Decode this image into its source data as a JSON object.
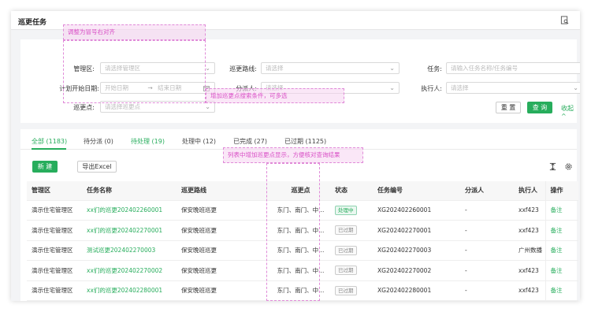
{
  "page_title": "巡更任务",
  "filters": {
    "area_label": "管理区:",
    "area_placeholder": "请选择管理区",
    "route_label": "巡更路线:",
    "route_placeholder": "请选择",
    "task_label": "任务:",
    "task_placeholder": "请输入任务名称/任务编号",
    "start_date_label": "计划开始日期:",
    "start_placeholder": "开始日期",
    "date_arrow": "→",
    "end_placeholder": "结束日期",
    "assigner_label": "分派人:",
    "assigner_placeholder": "请选择",
    "executor_label": "执行人:",
    "executor_placeholder": "请选择",
    "point_label": "巡更点:",
    "point_placeholder": "请选择巡更点",
    "reset_label": "重 置",
    "query_label": "查 询",
    "collapse_label": "收起 ^"
  },
  "tabs": [
    {
      "label": "全部 (1183)"
    },
    {
      "label": "待分派 (0)"
    },
    {
      "label": "待处理 (19)"
    },
    {
      "label": "处理中 (12)"
    },
    {
      "label": "已完成 (27)"
    },
    {
      "label": "已过期 (1125)"
    }
  ],
  "toolbar": {
    "new_label": "新 建",
    "export_label": "导出Excel"
  },
  "table": {
    "headers": [
      "管理区",
      "任务名称",
      "巡更路线",
      "巡更点",
      "状态",
      "任务编号",
      "分派人",
      "执行人",
      "操作"
    ],
    "rows": [
      {
        "area": "演示住宅管理区",
        "name": "xx们的巡更202402260001",
        "route": "保安晚班巡更",
        "points": "东门、南门、中...",
        "status": "处理中",
        "code": "XG202402260001",
        "assigner": "-",
        "executor": "xxf423",
        "op": "备注"
      },
      {
        "area": "演示住宅管理区",
        "name": "xx们的巡更202402270001",
        "route": "保安晚班巡更",
        "points": "东门、南门、中...",
        "status": "已过期",
        "code": "XG202402270001",
        "assigner": "-",
        "executor": "xxf423",
        "op": "备注"
      },
      {
        "area": "演示住宅管理区",
        "name": "测试巡更202402270003",
        "route": "保安晚班巡更",
        "points": "东门、南门、中...",
        "status": "已过期",
        "code": "XG202402270003",
        "assigner": "-",
        "executor": "广州数播",
        "op": "备注"
      },
      {
        "area": "演示住宅管理区",
        "name": "xx们的巡更202402270002",
        "route": "保安晚班巡更",
        "points": "东门、南门、中...",
        "status": "已过期",
        "code": "XG202402270002",
        "assigner": "-",
        "executor": "xxf423",
        "op": "备注"
      },
      {
        "area": "演示住宅管理区",
        "name": "xx们的巡更202402280001",
        "route": "保安晚班巡更",
        "points": "东门、南门、中...",
        "status": "已过期",
        "code": "XG202402280001",
        "assigner": "-",
        "executor": "xxf423",
        "op": "备注"
      }
    ]
  },
  "annotations": {
    "colon_align": "调整为冒号右对齐",
    "add_filter": "增加巡更点搜索条件，可多选",
    "add_column": "列表中增加巡更点显示，方便核对查询结果"
  },
  "colors": {
    "accent": "#27ad5c",
    "annotation": "#d94fc6"
  },
  "icons": [
    "report-icon",
    "column-height-icon",
    "settings-icon",
    "chevron-down-icon",
    "calendar-icon"
  ]
}
